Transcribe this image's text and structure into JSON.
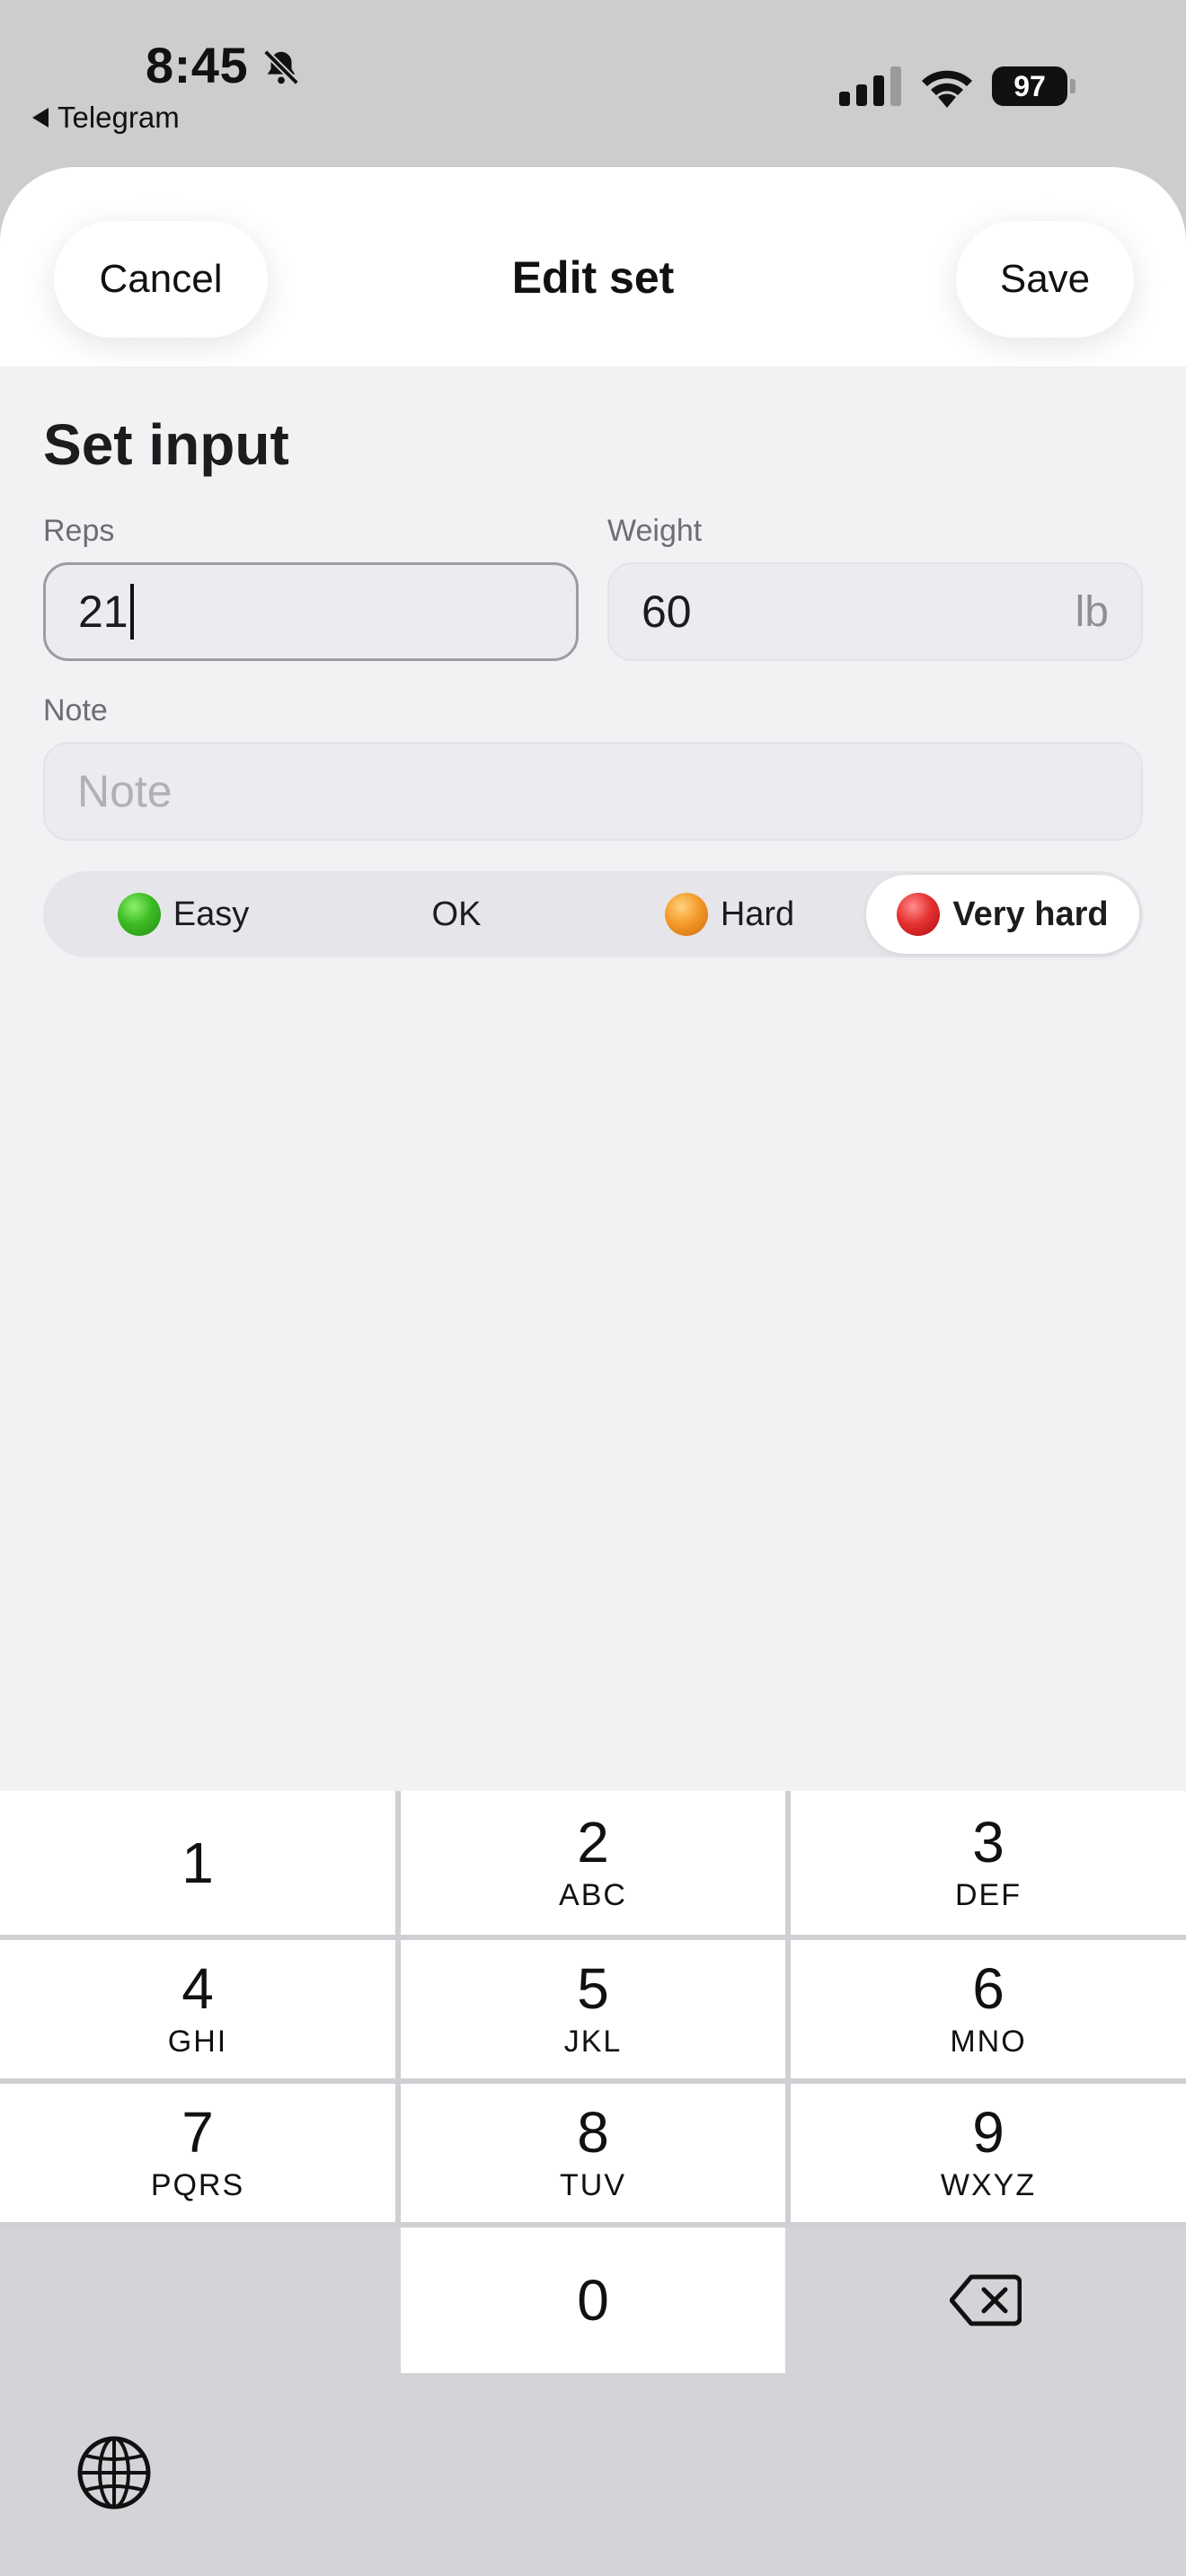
{
  "status_bar": {
    "time": "8:45",
    "back_app": "Telegram",
    "battery": "97"
  },
  "header": {
    "cancel_label": "Cancel",
    "title": "Edit set",
    "save_label": "Save"
  },
  "form": {
    "section_title": "Set input",
    "reps": {
      "label": "Reps",
      "value": "21"
    },
    "weight": {
      "label": "Weight",
      "value": "60",
      "unit": "lb"
    },
    "note": {
      "label": "Note",
      "placeholder": "Note"
    }
  },
  "difficulty": {
    "options": [
      {
        "label": "Easy",
        "icon": "green-circle-icon"
      },
      {
        "label": "OK"
      },
      {
        "label": "Hard",
        "icon": "orange-circle-icon"
      },
      {
        "label": "Very hard",
        "icon": "red-circle-icon"
      }
    ],
    "selected": "Very hard"
  },
  "keypad": {
    "keys": [
      {
        "num": "1",
        "letters": ""
      },
      {
        "num": "2",
        "letters": "ABC"
      },
      {
        "num": "3",
        "letters": "DEF"
      },
      {
        "num": "4",
        "letters": "GHI"
      },
      {
        "num": "5",
        "letters": "JKL"
      },
      {
        "num": "6",
        "letters": "MNO"
      },
      {
        "num": "7",
        "letters": "PQRS"
      },
      {
        "num": "8",
        "letters": "TUV"
      },
      {
        "num": "9",
        "letters": "WXYZ"
      },
      {
        "num": "0",
        "letters": ""
      }
    ]
  }
}
